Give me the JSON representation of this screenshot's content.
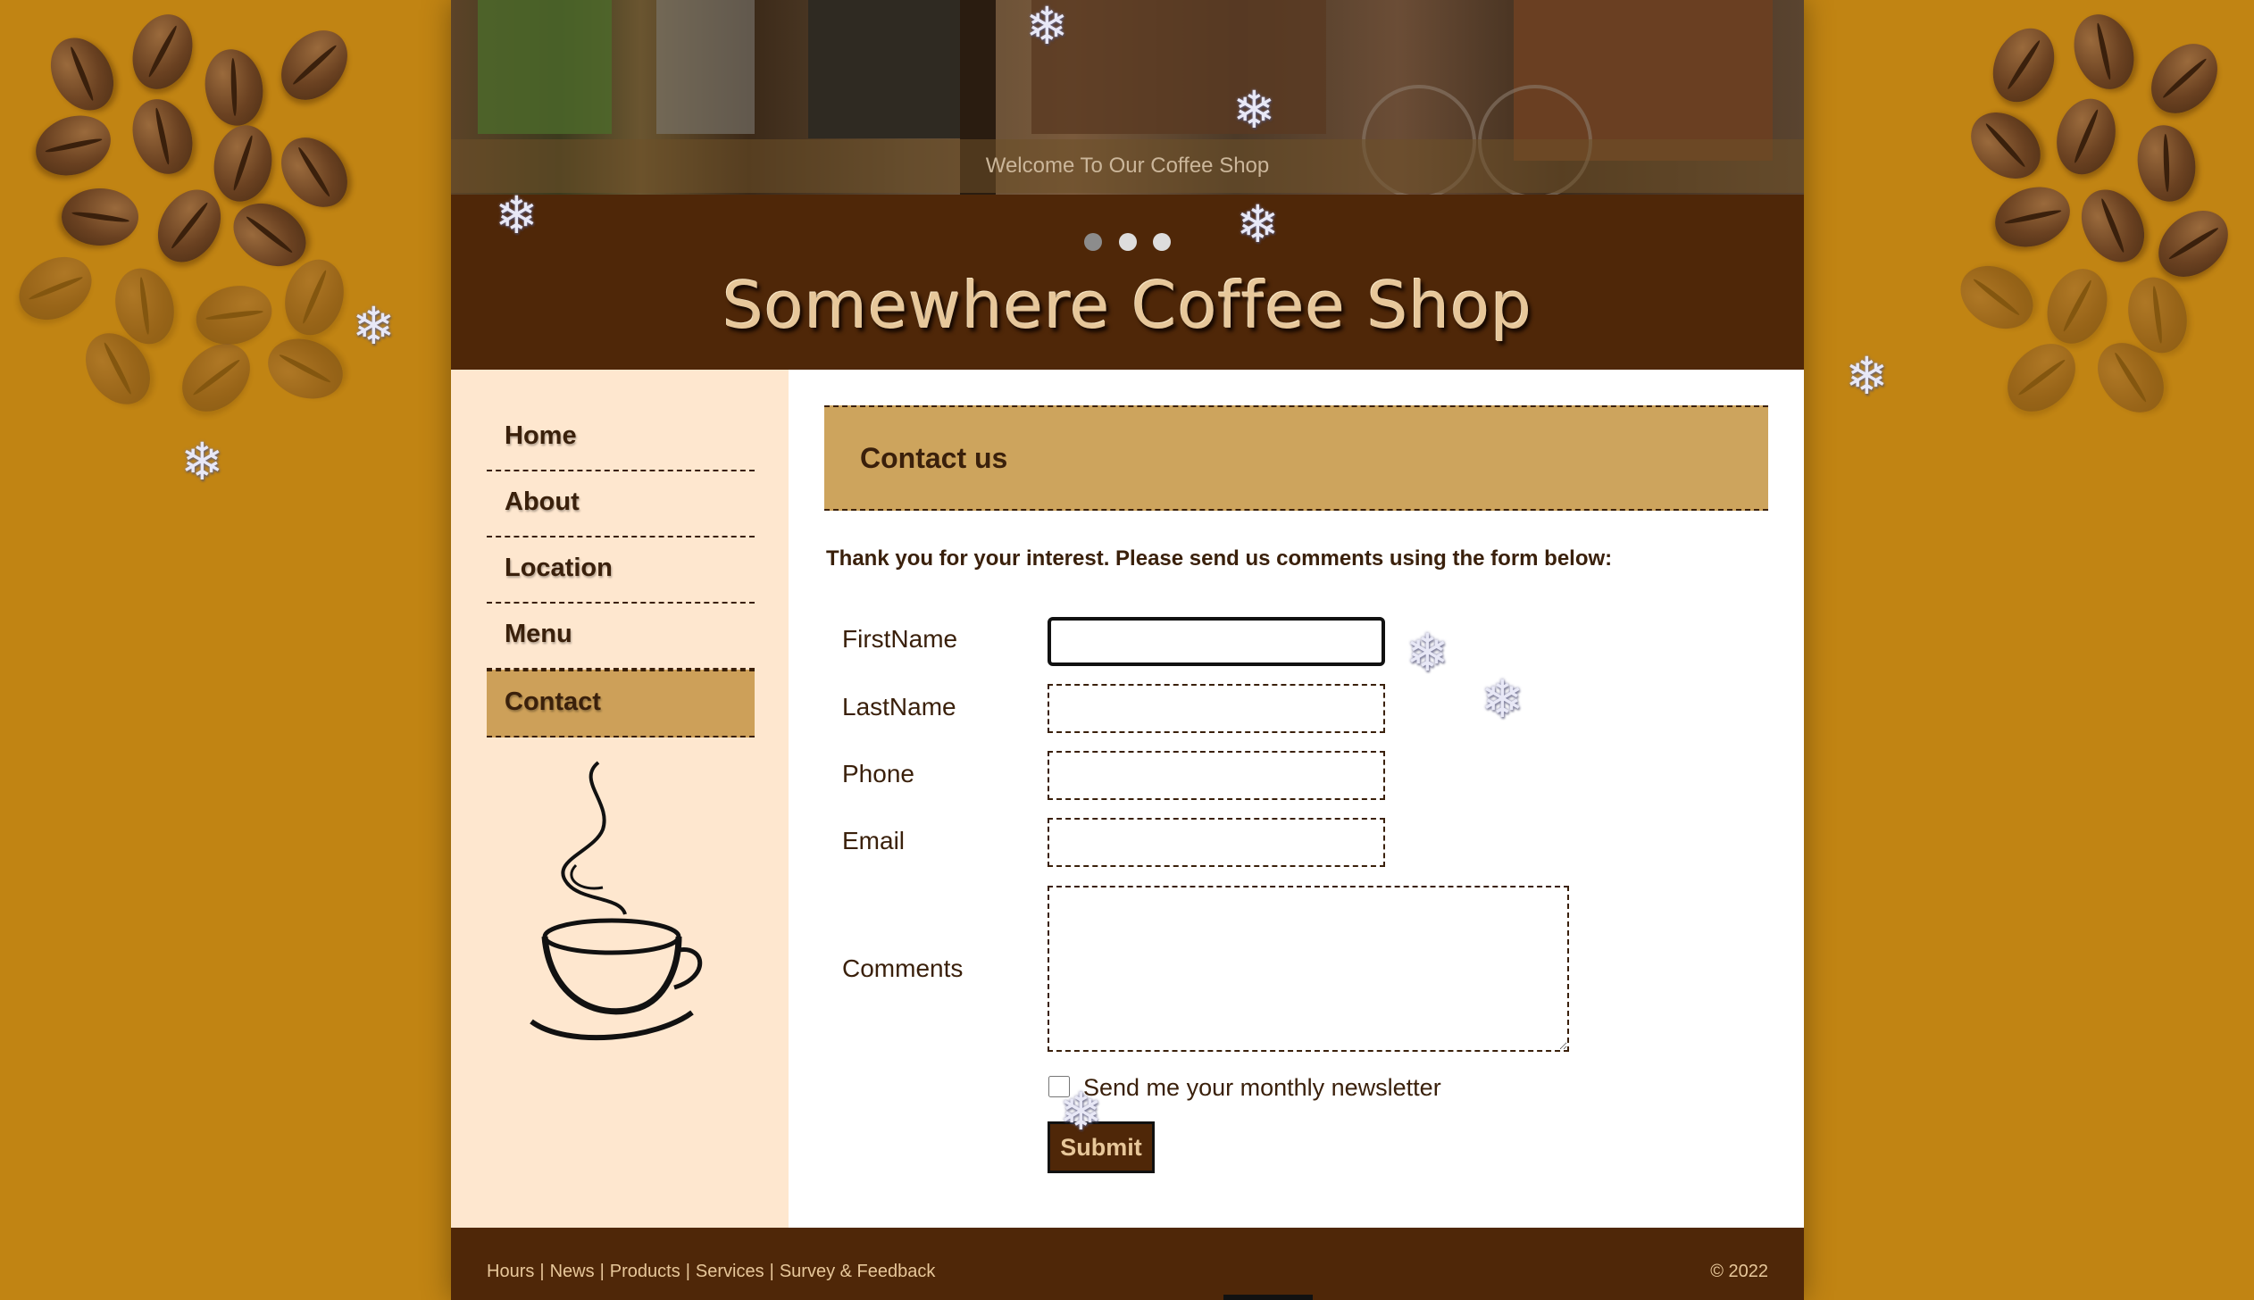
{
  "slideshow": {
    "caption": "Welcome To Our Coffee Shop",
    "slides": 3,
    "active_slide": 1
  },
  "site_title": "Somewhere Coffee Shop",
  "nav": {
    "items": [
      {
        "label": "Home"
      },
      {
        "label": "About"
      },
      {
        "label": "Location"
      },
      {
        "label": "Menu"
      },
      {
        "label": "Contact",
        "active": true
      }
    ]
  },
  "main": {
    "heading": "Contact us",
    "intro": "Thank you for your interest. Please send us comments using the form below:"
  },
  "form": {
    "first_name_label": "FirstName",
    "first_name_value": "",
    "last_name_label": "LastName",
    "last_name_value": "",
    "phone_label": "Phone",
    "phone_value": "",
    "email_label": "Email",
    "email_value": "",
    "comments_label": "Comments",
    "comments_value": "",
    "newsletter_label": "Send me your monthly newsletter",
    "newsletter_checked": false,
    "submit_label": "Submit"
  },
  "footer": {
    "links": [
      "Hours",
      "News",
      "Products",
      "Services",
      "Survey & Feedback"
    ],
    "copyright": "© 2022"
  },
  "colors": {
    "page_background": "#c18413",
    "header_brown": "#4f2708",
    "accent_tan": "#cda45d",
    "sidebar_cream": "#fee7cf",
    "text_dark": "#3a200b"
  },
  "icons": [
    "snowflake-icon",
    "coffee-cup-icon",
    "coffee-bean-icon"
  ]
}
